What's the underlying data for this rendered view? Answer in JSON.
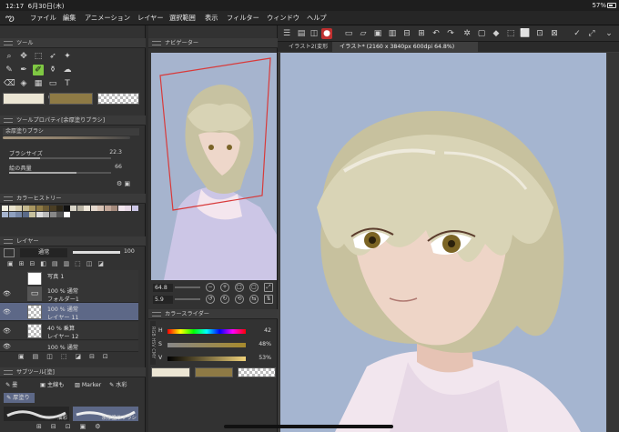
{
  "status_bar": {
    "time": "12:17",
    "date": "6月30日(木)",
    "battery": "57%"
  },
  "menu": {
    "items": [
      "ファイル",
      "編集",
      "アニメーション",
      "レイヤー",
      "選択範囲",
      "表示",
      "フィルター",
      "ウィンドウ",
      "ヘルプ"
    ]
  },
  "tool_panel": {
    "title": "ツール"
  },
  "tool_property": {
    "title": "ツールプロパティ[余厚塗りブラシ]",
    "brush_name": "余厚塗りブラシ",
    "brush_size_label": "ブラシサイズ",
    "brush_size_value": "22.3",
    "paint_amount_label": "絵の具量",
    "paint_amount_value": "66"
  },
  "color_history": {
    "title": "カラーヒストリー"
  },
  "layer_panel": {
    "title": "レイヤー",
    "blend_mode": "通常",
    "opacity": "100",
    "layers": [
      {
        "line1": "写真 1",
        "line2": ""
      },
      {
        "line1": "100 % 通常",
        "line2": "フォルダー1"
      },
      {
        "line1": "100 % 通常",
        "line2": "レイヤー 11"
      },
      {
        "line1": "40 % 乗算",
        "line2": "レイヤー 12"
      },
      {
        "line1": "100 % 通常",
        "line2": ""
      }
    ]
  },
  "subtool": {
    "title": "サブツール[塗]",
    "items": [
      "墨",
      "主線も",
      "Marker",
      "水彩",
      "厚塗り"
    ],
    "brush_label_1": "油彩",
    "brush_label_2": "余厚塗りブラシ"
  },
  "navigator": {
    "title": "ナビゲーター",
    "zoom": "64.8",
    "rotation": "5.9"
  },
  "color_slider": {
    "title": "カラースライダー",
    "rows": [
      {
        "label": "H",
        "value": "42"
      },
      {
        "label": "S",
        "value": "48%"
      },
      {
        "label": "V",
        "value": "53%"
      }
    ]
  },
  "canvas": {
    "tab_1": "イラスト2(変形",
    "tab_2": "イラスト* (2160 x 3840px 600dpi 64.8%)"
  },
  "colors": {
    "main_color": "#ece6d4",
    "sub_color": "#8e7a45",
    "accent": "#7fc843",
    "canvas_bg": "#a5b5d0"
  }
}
